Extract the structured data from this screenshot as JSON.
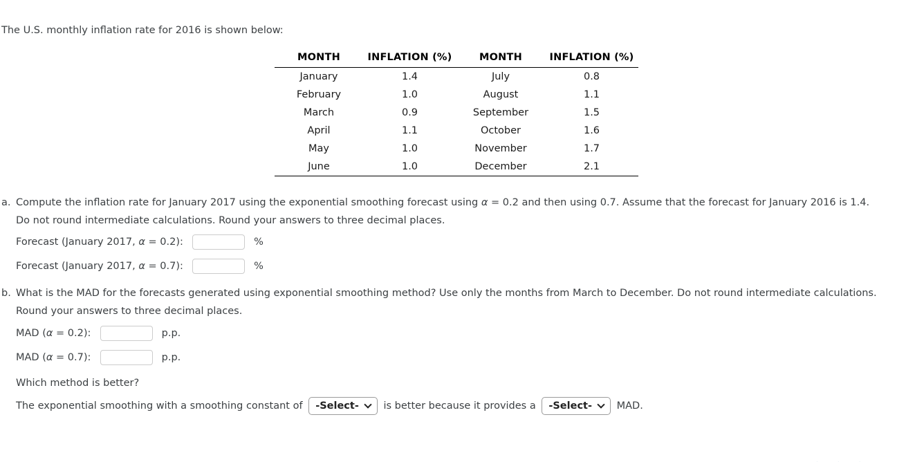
{
  "intro": "The U.S. monthly inflation rate for 2016 is shown below:",
  "table": {
    "headers": [
      "MONTH",
      "INFLATION (%)",
      "MONTH",
      "INFLATION (%)"
    ],
    "rows": [
      [
        "January",
        "1.4",
        "July",
        "0.8"
      ],
      [
        "February",
        "1.0",
        "August",
        "1.1"
      ],
      [
        "March",
        "0.9",
        "September",
        "1.5"
      ],
      [
        "April",
        "1.1",
        "October",
        "1.6"
      ],
      [
        "May",
        "1.0",
        "November",
        "1.7"
      ],
      [
        "June",
        "1.0",
        "December",
        "2.1"
      ]
    ]
  },
  "question_a": {
    "marker": "a.",
    "line1_part1": "Compute the inflation rate for January 2017 using the exponential smoothing forecast using ",
    "alpha": "α",
    "line1_part2": " = 0.2 and then using 0.7. Assume that the forecast for January 2016 is 1.4.",
    "line2": "Do not round intermediate calculations. Round your answers to three decimal places.",
    "fields": [
      {
        "label_pre": "Forecast (January 2017, ",
        "alpha": "α",
        "label_post": " = 0.2):",
        "value": "",
        "placeholder": "",
        "unit": "%"
      },
      {
        "label_pre": "Forecast (January 2017, ",
        "alpha": "α",
        "label_post": " = 0.7):",
        "value": "",
        "placeholder": "",
        "unit": "%"
      }
    ]
  },
  "question_b": {
    "marker": "b.",
    "line1": "What is the MAD for the forecasts generated using exponential smoothing method? Use only the months from March to December. Do not round intermediate calculations.",
    "line2": "Round your answers to three decimal places.",
    "fields": [
      {
        "label_pre": "MAD (",
        "alpha": "α",
        "label_post": " = 0.2):",
        "value": "",
        "placeholder": "",
        "unit": "p.p."
      },
      {
        "label_pre": "MAD (",
        "alpha": "α",
        "label_post": " = 0.7):",
        "value": "",
        "placeholder": "",
        "unit": "p.p."
      }
    ],
    "which_better": "Which method is better?",
    "conclusion": {
      "pre": "The exponential smoothing with a smoothing constant of",
      "select1": "-Select-",
      "mid": "is better because it provides a",
      "select2": "-Select-",
      "post": "MAD."
    }
  }
}
